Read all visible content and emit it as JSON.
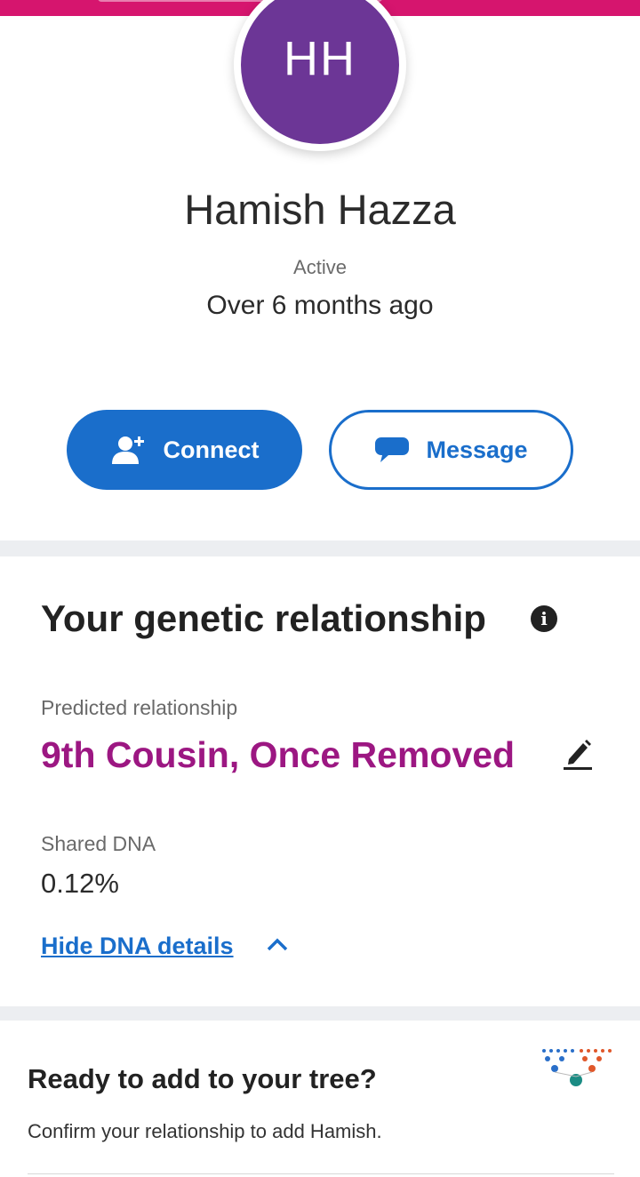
{
  "header": {
    "bar_color": "#d6156e"
  },
  "profile": {
    "initials": "HH",
    "avatar_color": "#6c3696",
    "name": "Hamish Hazza",
    "status_label": "Active",
    "status_value": "Over 6 months ago"
  },
  "actions": {
    "connect_label": "Connect",
    "message_label": "Message",
    "accent_color": "#1a6ecb"
  },
  "genetic": {
    "title": "Your genetic relationship",
    "predicted_label": "Predicted relationship",
    "predicted_value": "9th Cousin, Once Removed",
    "relationship_color": "#9c1782",
    "shared_label": "Shared DNA",
    "shared_value": "0.12%",
    "hide_link": "Hide DNA details"
  },
  "tree": {
    "title": "Ready to add to your tree?",
    "subtitle": "Confirm your relationship to add Hamish."
  },
  "icons": [
    "add-person-icon",
    "chat-bubble-icon",
    "info-icon",
    "pencil-icon",
    "chevron-up-icon",
    "family-tree-icon"
  ]
}
